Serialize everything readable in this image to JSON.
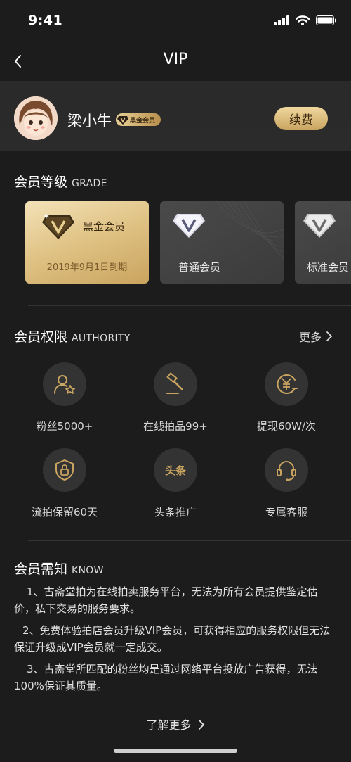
{
  "status": {
    "time": "9:41"
  },
  "nav": {
    "title": "VIP"
  },
  "profile": {
    "name": "梁小牛",
    "badge_label": "黑金会员",
    "renew_label": "续费"
  },
  "grade": {
    "title": "会员等级",
    "title_en": "GRADE",
    "cards": [
      {
        "name": "黑金会员",
        "expiry": "2019年9月1日到期"
      },
      {
        "name": "普通会员"
      },
      {
        "name": "标准会员"
      }
    ]
  },
  "authority": {
    "title": "会员权限",
    "title_en": "AUTHORITY",
    "more_label": "更多",
    "perks": [
      {
        "label": "粉丝5000+",
        "icon": "fans-star-icon"
      },
      {
        "label": "在线拍品99+",
        "icon": "auction-hammer-icon"
      },
      {
        "label": "提现60W/次",
        "icon": "yuan-withdraw-icon"
      },
      {
        "label": "流拍保留60天",
        "icon": "shield-lock-icon"
      },
      {
        "label": "头条推广",
        "icon": "headline-icon",
        "icon_text": "头条"
      },
      {
        "label": "专属客服",
        "icon": "headset-icon"
      }
    ]
  },
  "notice": {
    "title": "会员需知",
    "title_en": "KNOW",
    "items": [
      "1、古斋堂拍为在线拍卖服务平台，无法为所有会员提供鉴定估价，私下交易的服务要求。",
      "2、免费体验拍店会员升级VIP会员，可获得相应的服务权限但无法保证升级成VIP会员就一定成交。",
      "3、古斋堂所匹配的粉丝均是通过网络平台投放广告获得，无法100%保证其质量。"
    ],
    "learn_more_label": "了解更多"
  },
  "colors": {
    "background": "#1c1c1c",
    "gold": "#c9a460",
    "gold_light": "#f0d89e",
    "circle": "#333333"
  }
}
